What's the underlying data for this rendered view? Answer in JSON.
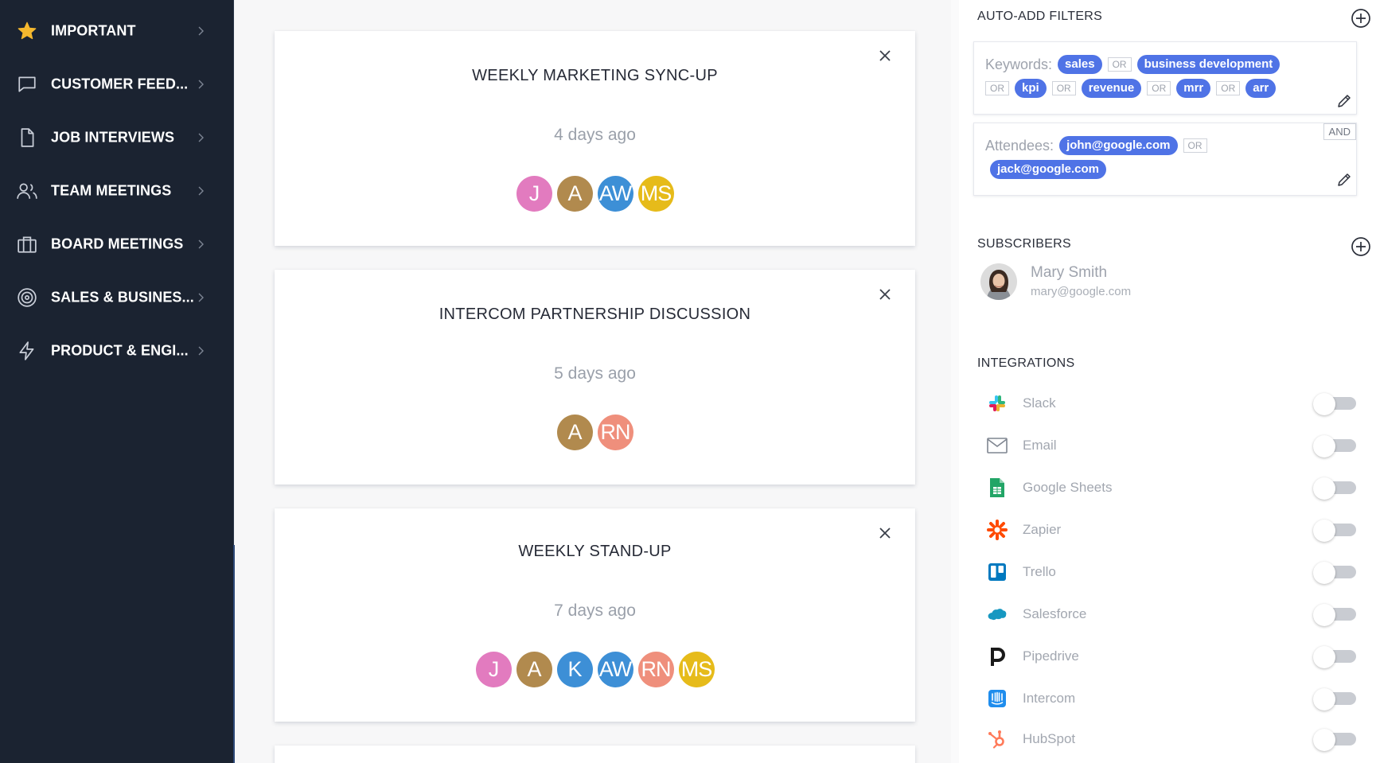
{
  "sidebar": {
    "items": [
      {
        "label": "IMPORTANT",
        "icon": "star-icon"
      },
      {
        "label": "CUSTOMER FEED...",
        "icon": "chat-bubble-icon"
      },
      {
        "label": "JOB INTERVIEWS",
        "icon": "document-icon"
      },
      {
        "label": "TEAM MEETINGS",
        "icon": "users-icon"
      },
      {
        "label": "BOARD MEETINGS",
        "icon": "briefcase-icon"
      },
      {
        "label": "SALES & BUSINES...",
        "icon": "target-icon"
      },
      {
        "label": "PRODUCT & ENGI...",
        "icon": "lightning-icon"
      }
    ]
  },
  "meetings": [
    {
      "title": "WEEKLY MARKETING SYNC-UP",
      "time": "4 days ago",
      "attendees": [
        {
          "initials": "J",
          "color": "#e27bbf"
        },
        {
          "initials": "A",
          "color": "#b18a4e"
        },
        {
          "initials": "AW",
          "color": "#3d8fd6"
        },
        {
          "initials": "MS",
          "color": "#e6bb1a"
        }
      ]
    },
    {
      "title": "INTERCOM PARTNERSHIP DISCUSSION",
      "time": "5 days ago",
      "attendees": [
        {
          "initials": "A",
          "color": "#b18a4e"
        },
        {
          "initials": "RN",
          "color": "#ef8f7c"
        }
      ]
    },
    {
      "title": "WEEKLY STAND-UP",
      "time": "7 days ago",
      "attendees": [
        {
          "initials": "J",
          "color": "#e27bbf"
        },
        {
          "initials": "A",
          "color": "#b18a4e"
        },
        {
          "initials": "K",
          "color": "#3d8fd6"
        },
        {
          "initials": "AW",
          "color": "#3d8fd6"
        },
        {
          "initials": "RN",
          "color": "#ef8f7c"
        },
        {
          "initials": "MS",
          "color": "#e6bb1a"
        }
      ]
    }
  ],
  "auto_add": {
    "title": "AUTO-ADD FILTERS",
    "keywords_label": "Keywords:",
    "keywords": [
      "sales",
      "business development",
      "kpi",
      "revenue",
      "mrr",
      "arr"
    ],
    "attendees_label": "Attendees:",
    "attendees": [
      "john@google.com",
      "jack@google.com"
    ],
    "or_label": "OR",
    "and_label": "AND"
  },
  "subscribers": {
    "title": "SUBSCRIBERS",
    "people": [
      {
        "name": "Mary Smith",
        "email": "mary@google.com"
      }
    ]
  },
  "integrations": {
    "title": "INTEGRATIONS",
    "items": [
      {
        "name": "Slack",
        "icon": "slack-icon",
        "enabled": false
      },
      {
        "name": "Email",
        "icon": "email-icon",
        "enabled": false
      },
      {
        "name": "Google Sheets",
        "icon": "google-sheets-icon",
        "enabled": false
      },
      {
        "name": "Zapier",
        "icon": "zapier-icon",
        "enabled": false
      },
      {
        "name": "Trello",
        "icon": "trello-icon",
        "enabled": false
      },
      {
        "name": "Salesforce",
        "icon": "salesforce-icon",
        "enabled": false
      },
      {
        "name": "Pipedrive",
        "icon": "pipedrive-icon",
        "enabled": false
      },
      {
        "name": "Intercom",
        "icon": "intercom-icon",
        "enabled": false
      },
      {
        "name": "HubSpot",
        "icon": "hubspot-icon",
        "enabled": false
      }
    ]
  },
  "colors": {
    "sidebar_bg": "#1b2331",
    "chip_blue": "#4f73e6",
    "star_gold": "#f5b82e"
  }
}
